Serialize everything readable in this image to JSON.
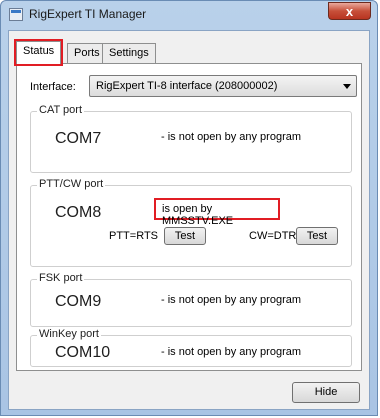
{
  "window": {
    "title": "RigExpert TI Manager",
    "close_label": "x"
  },
  "tabs": [
    {
      "label": "Status",
      "active": true
    },
    {
      "label": "Ports",
      "active": false
    },
    {
      "label": "Settings",
      "active": false
    }
  ],
  "interface": {
    "label": "Interface:",
    "value": "RigExpert TI-8 interface (208000002)"
  },
  "ports": {
    "cat": {
      "title": "CAT port",
      "com": "COM7",
      "status": "- is not open by any program"
    },
    "ptt_cw": {
      "title": "PTT/CW port",
      "com": "COM8",
      "status": "is open by MMSSTV.EXE",
      "ptt_label": "PTT=RTS",
      "cw_label": "CW=DTR",
      "test_label": "Test"
    },
    "fsk": {
      "title": "FSK port",
      "com": "COM9",
      "status": "- is not open by any program"
    },
    "winkey": {
      "title": "WinKey port",
      "com": "COM10",
      "status": "- is not open by any program"
    }
  },
  "footer": {
    "hide_label": "Hide"
  },
  "colors": {
    "highlight": "#e11d24",
    "titlebar": "#b9d1ea",
    "close": "#c7503a"
  },
  "icons": {
    "app": "app-window-icon",
    "close": "close-icon",
    "dropdown": "chevron-down-icon"
  }
}
